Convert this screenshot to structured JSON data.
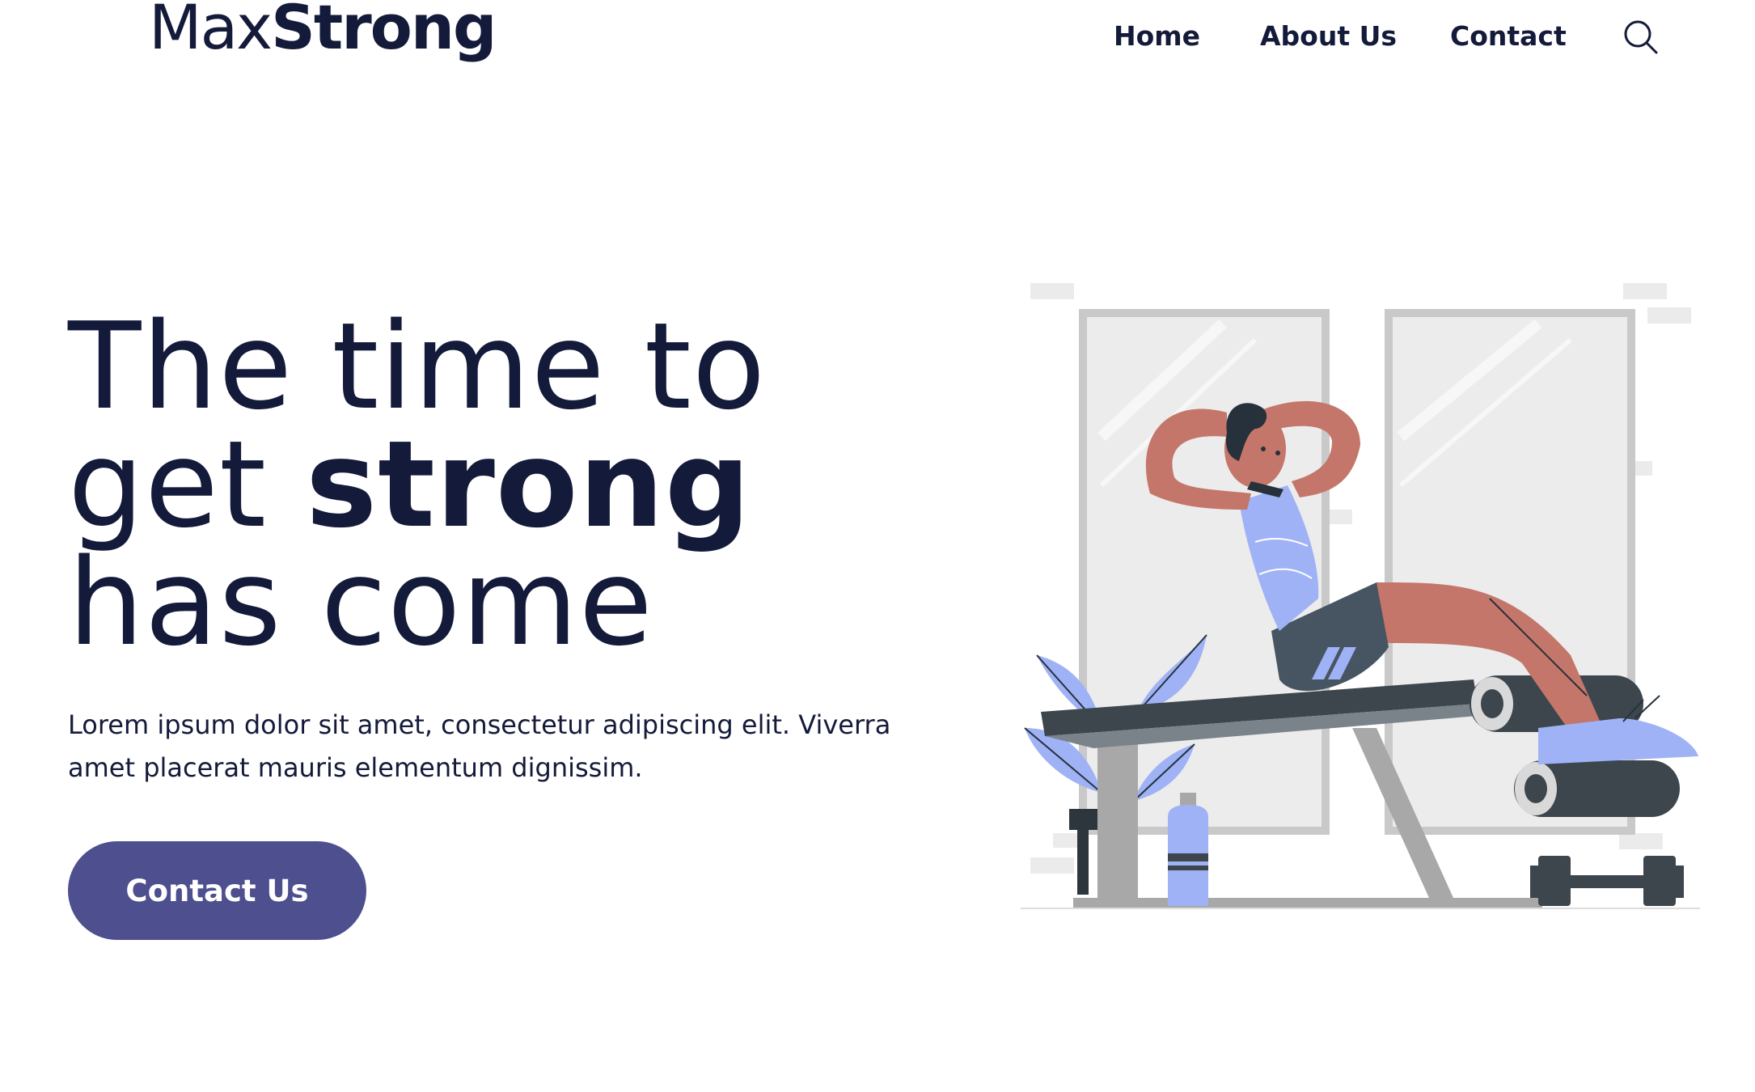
{
  "header": {
    "logo_light": "Max",
    "logo_bold": "Strong",
    "nav": [
      {
        "label": "Home"
      },
      {
        "label": "About Us"
      },
      {
        "label": "Contact"
      }
    ],
    "search_icon": "search-icon"
  },
  "hero": {
    "title_line1": "The time to",
    "title_line2_prefix": "get ",
    "title_line2_bold": "strong",
    "title_line3": "has come",
    "description": "Lorem ipsum dolor sit amet, consectetur adipiscing elit. Viverra amet placerat mauris elementum dignissim.",
    "cta_label": "Contact Us"
  },
  "illustration": {
    "subject": "person doing sit-ups on a decline bench in a gym",
    "colors": {
      "skin": "#c4766a",
      "shirt": "#9fb2f5",
      "shorts": "#465561",
      "bench": "#3d464d",
      "frame": "#c9c9c9",
      "mirror": "#ececec",
      "hair": "#26313b"
    }
  },
  "colors": {
    "text": "#141a3a",
    "accent": "#4d4f8e",
    "background": "#ffffff"
  }
}
